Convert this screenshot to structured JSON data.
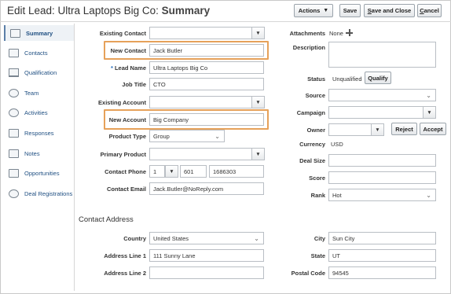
{
  "header": {
    "title_prefix": "Edit Lead: Ultra Laptops Big Co",
    "title_sep": ":",
    "title_tail": "Summary",
    "actions_label": "Actions",
    "save_label": "Save",
    "save_close_first": "S",
    "save_close_rest": "ave and Close",
    "cancel_first": "C",
    "cancel_rest": "ancel"
  },
  "sidebar": {
    "items": [
      {
        "label": "Summary",
        "icon": "summary-icon",
        "active": true
      },
      {
        "label": "Contacts",
        "icon": "contacts-icon"
      },
      {
        "label": "Qualification",
        "icon": "scale-icon"
      },
      {
        "label": "Team",
        "icon": "team-icon"
      },
      {
        "label": "Activities",
        "icon": "activities-icon"
      },
      {
        "label": "Responses",
        "icon": "responses-icon"
      },
      {
        "label": "Notes",
        "icon": "notes-icon"
      },
      {
        "label": "Opportunities",
        "icon": "opportunities-icon"
      },
      {
        "label": "Deal Registrations",
        "icon": "deal-registrations-icon"
      }
    ]
  },
  "form": {
    "existing_contact": {
      "label": "Existing Contact",
      "value": ""
    },
    "new_contact": {
      "label": "New Contact",
      "value": "Jack Butler"
    },
    "lead_name": {
      "label": "Lead Name",
      "value": "Ultra Laptops Big Co",
      "required": "*"
    },
    "job_title": {
      "label": "Job Title",
      "value": "CTO"
    },
    "existing_account": {
      "label": "Existing Account",
      "value": ""
    },
    "new_account": {
      "label": "New Account",
      "value": "Big Company"
    },
    "product_type": {
      "label": "Product Type",
      "value": "Group"
    },
    "primary_product": {
      "label": "Primary Product",
      "value": ""
    },
    "contact_phone": {
      "label": "Contact Phone",
      "country": "1",
      "area": "601",
      "number": "1686303"
    },
    "contact_email": {
      "label": "Contact Email",
      "value": "Jack.Butler@NoReply.com"
    }
  },
  "right": {
    "attachments": {
      "label": "Attachments",
      "value": "None"
    },
    "description": {
      "label": "Description",
      "value": ""
    },
    "status": {
      "label": "Status",
      "value": "Unqualified",
      "button": "Qualify"
    },
    "source": {
      "label": "Source",
      "value": ""
    },
    "campaign": {
      "label": "Campaign",
      "value": ""
    },
    "owner": {
      "label": "Owner",
      "value": "",
      "reject": "Reject",
      "accept": "Accept"
    },
    "currency": {
      "label": "Currency",
      "value": "USD"
    },
    "deal_size": {
      "label": "Deal Size",
      "value": ""
    },
    "score": {
      "label": "Score",
      "value": ""
    },
    "rank": {
      "label": "Rank",
      "value": "Hot"
    }
  },
  "address": {
    "section_title": "Contact Address",
    "country": {
      "label": "Country",
      "value": "United States"
    },
    "line1": {
      "label": "Address Line 1",
      "value": "111 Sunny Lane"
    },
    "line2": {
      "label": "Address Line 2",
      "value": ""
    },
    "city": {
      "label": "City",
      "value": "Sun City"
    },
    "state": {
      "label": "State",
      "value": "UT"
    },
    "postal": {
      "label": "Postal Code",
      "value": "94545"
    }
  },
  "colors": {
    "highlight": "#e6a15a",
    "link": "#1f4f82"
  }
}
